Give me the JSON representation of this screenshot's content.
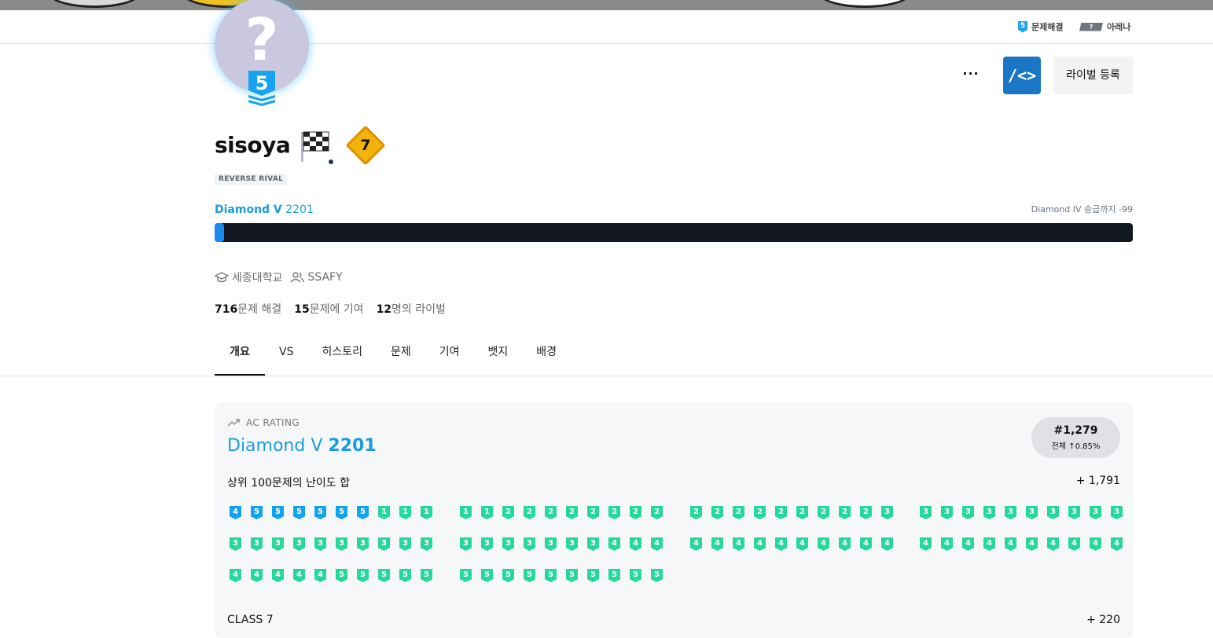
{
  "nav": {
    "solved_tier": "5",
    "solved_label": "문제해결",
    "arena_tier": "?",
    "arena_label": "아레나"
  },
  "profile": {
    "avatar_glyph": "?",
    "avatar_tier": "5",
    "username": "sisoya",
    "class_number": "7",
    "badge_text": "REVERSE RIVAL",
    "more_label": "···",
    "code_label": "/<>",
    "rival_button": "라이벌 등록",
    "tier_name": "Diamond V",
    "rating": "2201",
    "promo_text": "Diamond IV 승급까지 -99",
    "rating_progress_fraction": 0.01,
    "school": "세종대학교",
    "org": "SSAFY",
    "solved_count": "716",
    "solved_label": "문제 해결",
    "contrib_count": "15",
    "contrib_label": "문제에 기여",
    "rival_count": "12",
    "rival_label": "명의 라이벌"
  },
  "tabs": [
    "개요",
    "VS",
    "히스토리",
    "문제",
    "기여",
    "뱃지",
    "배경"
  ],
  "active_tab": "개요",
  "ac": {
    "label": "AC RATING",
    "tier_name": "Diamond V",
    "rating": "2201",
    "rank": "#1,279",
    "rank_pct": "전체 ↑0.85%",
    "top100_label": "상위 100문제의 난이도 합",
    "top100_value": "+ 1,791",
    "class_label": "CLASS 7",
    "class_value": "+ 220",
    "tier_groups": [
      [
        "d4",
        "d5",
        "d5",
        "d5",
        "d5",
        "d5",
        "d5",
        "r1",
        "r1",
        "r1"
      ],
      [
        "r1",
        "r1",
        "r2",
        "r2",
        "r2",
        "r2",
        "r2",
        "r2",
        "r2",
        "r2"
      ],
      [
        "r2",
        "r2",
        "r2",
        "r2",
        "r2",
        "r2",
        "r2",
        "r2",
        "r2",
        "r3"
      ],
      [
        "r3",
        "r3",
        "r3",
        "r3",
        "r3",
        "r3",
        "r3",
        "r3",
        "r3",
        "r3"
      ],
      [
        "r3",
        "r3",
        "r3",
        "r3",
        "r3",
        "r3",
        "r3",
        "r3",
        "r3",
        "r3"
      ],
      [
        "r3",
        "r3",
        "r3",
        "r3",
        "r3",
        "r3",
        "r3",
        "r4",
        "r4",
        "r4"
      ],
      [
        "r4",
        "r4",
        "r4",
        "r4",
        "r4",
        "r4",
        "r4",
        "r4",
        "r4",
        "r4"
      ],
      [
        "r4",
        "r4",
        "r4",
        "r4",
        "r4",
        "r4",
        "r4",
        "r4",
        "r4",
        "r4"
      ],
      [
        "r4",
        "r4",
        "r4",
        "r4",
        "r4",
        "r5",
        "r5",
        "r5",
        "r5",
        "r5"
      ],
      [
        "r5",
        "r5",
        "r5",
        "r5",
        "r5",
        "r5",
        "r5",
        "r5",
        "r5",
        "r5"
      ]
    ]
  },
  "colors": {
    "diamond": "#12a3ee",
    "ruby": "#27d89a",
    "tier_text": "#1c9be0",
    "code_button": "#1b77c6",
    "bar_bg": "#111820",
    "bar_fill": "#1a8cf0"
  }
}
